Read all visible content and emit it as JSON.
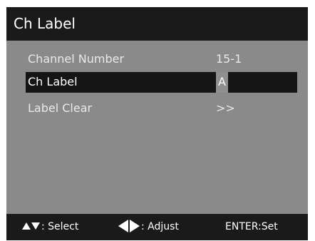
{
  "title": "Ch Label",
  "menu": {
    "items": [
      {
        "label": "Channel Number",
        "value": "15-1"
      },
      {
        "label": "Ch Label",
        "value": "A"
      },
      {
        "label": "Label Clear",
        "value": ">>"
      }
    ]
  },
  "footer": {
    "select_label": ": Select",
    "adjust_label": ": Adjust",
    "set_label": "ENTER:Set"
  },
  "icons": {
    "up": "triangle-up",
    "down": "triangle-down",
    "left": "triangle-left",
    "right": "triangle-right"
  },
  "colors": {
    "osd_background": "#8a8a8a",
    "bar_background": "#1a1a1a",
    "highlight": "#151515",
    "text": "#ffffff"
  }
}
